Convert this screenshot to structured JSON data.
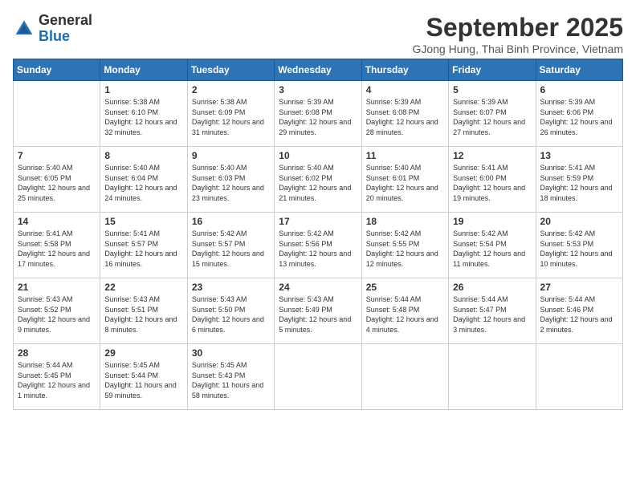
{
  "header": {
    "logo_general": "General",
    "logo_blue": "Blue",
    "month_title": "September 2025",
    "subtitle": "GJong Hung, Thai Binh Province, Vietnam"
  },
  "columns": [
    "Sunday",
    "Monday",
    "Tuesday",
    "Wednesday",
    "Thursday",
    "Friday",
    "Saturday"
  ],
  "weeks": [
    [
      {
        "day": "",
        "sunrise": "",
        "sunset": "",
        "daylight": ""
      },
      {
        "day": "1",
        "sunrise": "Sunrise: 5:38 AM",
        "sunset": "Sunset: 6:10 PM",
        "daylight": "Daylight: 12 hours and 32 minutes."
      },
      {
        "day": "2",
        "sunrise": "Sunrise: 5:38 AM",
        "sunset": "Sunset: 6:09 PM",
        "daylight": "Daylight: 12 hours and 31 minutes."
      },
      {
        "day": "3",
        "sunrise": "Sunrise: 5:39 AM",
        "sunset": "Sunset: 6:08 PM",
        "daylight": "Daylight: 12 hours and 29 minutes."
      },
      {
        "day": "4",
        "sunrise": "Sunrise: 5:39 AM",
        "sunset": "Sunset: 6:08 PM",
        "daylight": "Daylight: 12 hours and 28 minutes."
      },
      {
        "day": "5",
        "sunrise": "Sunrise: 5:39 AM",
        "sunset": "Sunset: 6:07 PM",
        "daylight": "Daylight: 12 hours and 27 minutes."
      },
      {
        "day": "6",
        "sunrise": "Sunrise: 5:39 AM",
        "sunset": "Sunset: 6:06 PM",
        "daylight": "Daylight: 12 hours and 26 minutes."
      }
    ],
    [
      {
        "day": "7",
        "sunrise": "Sunrise: 5:40 AM",
        "sunset": "Sunset: 6:05 PM",
        "daylight": "Daylight: 12 hours and 25 minutes."
      },
      {
        "day": "8",
        "sunrise": "Sunrise: 5:40 AM",
        "sunset": "Sunset: 6:04 PM",
        "daylight": "Daylight: 12 hours and 24 minutes."
      },
      {
        "day": "9",
        "sunrise": "Sunrise: 5:40 AM",
        "sunset": "Sunset: 6:03 PM",
        "daylight": "Daylight: 12 hours and 23 minutes."
      },
      {
        "day": "10",
        "sunrise": "Sunrise: 5:40 AM",
        "sunset": "Sunset: 6:02 PM",
        "daylight": "Daylight: 12 hours and 21 minutes."
      },
      {
        "day": "11",
        "sunrise": "Sunrise: 5:40 AM",
        "sunset": "Sunset: 6:01 PM",
        "daylight": "Daylight: 12 hours and 20 minutes."
      },
      {
        "day": "12",
        "sunrise": "Sunrise: 5:41 AM",
        "sunset": "Sunset: 6:00 PM",
        "daylight": "Daylight: 12 hours and 19 minutes."
      },
      {
        "day": "13",
        "sunrise": "Sunrise: 5:41 AM",
        "sunset": "Sunset: 5:59 PM",
        "daylight": "Daylight: 12 hours and 18 minutes."
      }
    ],
    [
      {
        "day": "14",
        "sunrise": "Sunrise: 5:41 AM",
        "sunset": "Sunset: 5:58 PM",
        "daylight": "Daylight: 12 hours and 17 minutes."
      },
      {
        "day": "15",
        "sunrise": "Sunrise: 5:41 AM",
        "sunset": "Sunset: 5:57 PM",
        "daylight": "Daylight: 12 hours and 16 minutes."
      },
      {
        "day": "16",
        "sunrise": "Sunrise: 5:42 AM",
        "sunset": "Sunset: 5:57 PM",
        "daylight": "Daylight: 12 hours and 15 minutes."
      },
      {
        "day": "17",
        "sunrise": "Sunrise: 5:42 AM",
        "sunset": "Sunset: 5:56 PM",
        "daylight": "Daylight: 12 hours and 13 minutes."
      },
      {
        "day": "18",
        "sunrise": "Sunrise: 5:42 AM",
        "sunset": "Sunset: 5:55 PM",
        "daylight": "Daylight: 12 hours and 12 minutes."
      },
      {
        "day": "19",
        "sunrise": "Sunrise: 5:42 AM",
        "sunset": "Sunset: 5:54 PM",
        "daylight": "Daylight: 12 hours and 11 minutes."
      },
      {
        "day": "20",
        "sunrise": "Sunrise: 5:42 AM",
        "sunset": "Sunset: 5:53 PM",
        "daylight": "Daylight: 12 hours and 10 minutes."
      }
    ],
    [
      {
        "day": "21",
        "sunrise": "Sunrise: 5:43 AM",
        "sunset": "Sunset: 5:52 PM",
        "daylight": "Daylight: 12 hours and 9 minutes."
      },
      {
        "day": "22",
        "sunrise": "Sunrise: 5:43 AM",
        "sunset": "Sunset: 5:51 PM",
        "daylight": "Daylight: 12 hours and 8 minutes."
      },
      {
        "day": "23",
        "sunrise": "Sunrise: 5:43 AM",
        "sunset": "Sunset: 5:50 PM",
        "daylight": "Daylight: 12 hours and 6 minutes."
      },
      {
        "day": "24",
        "sunrise": "Sunrise: 5:43 AM",
        "sunset": "Sunset: 5:49 PM",
        "daylight": "Daylight: 12 hours and 5 minutes."
      },
      {
        "day": "25",
        "sunrise": "Sunrise: 5:44 AM",
        "sunset": "Sunset: 5:48 PM",
        "daylight": "Daylight: 12 hours and 4 minutes."
      },
      {
        "day": "26",
        "sunrise": "Sunrise: 5:44 AM",
        "sunset": "Sunset: 5:47 PM",
        "daylight": "Daylight: 12 hours and 3 minutes."
      },
      {
        "day": "27",
        "sunrise": "Sunrise: 5:44 AM",
        "sunset": "Sunset: 5:46 PM",
        "daylight": "Daylight: 12 hours and 2 minutes."
      }
    ],
    [
      {
        "day": "28",
        "sunrise": "Sunrise: 5:44 AM",
        "sunset": "Sunset: 5:45 PM",
        "daylight": "Daylight: 12 hours and 1 minute."
      },
      {
        "day": "29",
        "sunrise": "Sunrise: 5:45 AM",
        "sunset": "Sunset: 5:44 PM",
        "daylight": "Daylight: 11 hours and 59 minutes."
      },
      {
        "day": "30",
        "sunrise": "Sunrise: 5:45 AM",
        "sunset": "Sunset: 5:43 PM",
        "daylight": "Daylight: 11 hours and 58 minutes."
      },
      {
        "day": "",
        "sunrise": "",
        "sunset": "",
        "daylight": ""
      },
      {
        "day": "",
        "sunrise": "",
        "sunset": "",
        "daylight": ""
      },
      {
        "day": "",
        "sunrise": "",
        "sunset": "",
        "daylight": ""
      },
      {
        "day": "",
        "sunrise": "",
        "sunset": "",
        "daylight": ""
      }
    ]
  ]
}
